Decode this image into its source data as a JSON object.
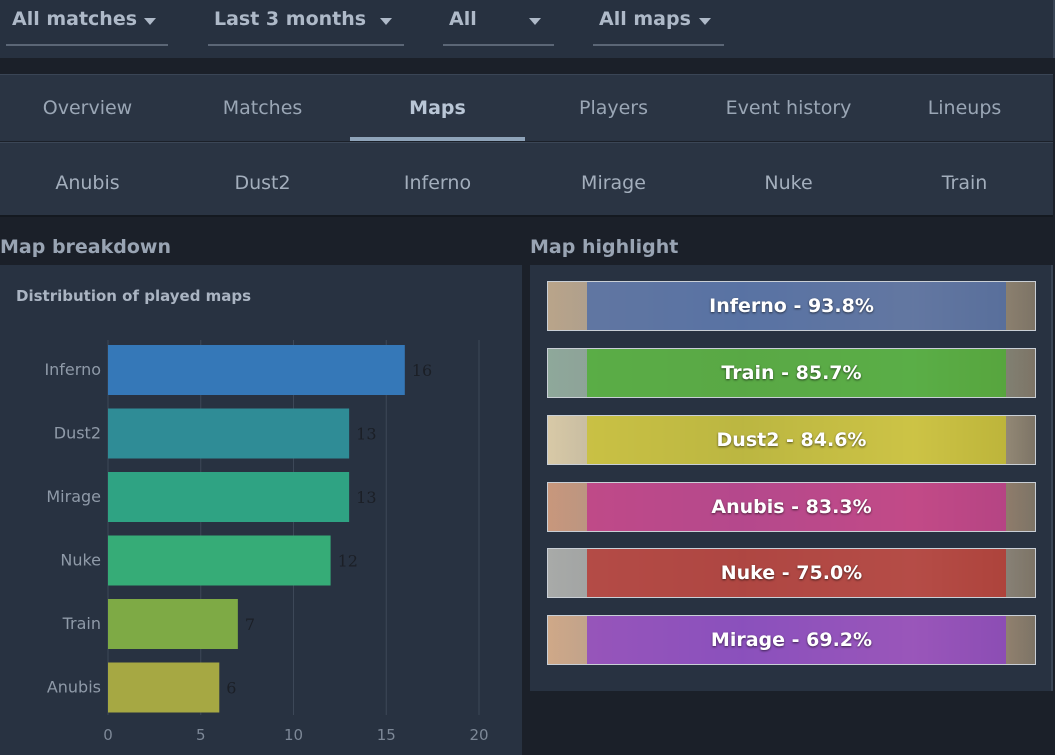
{
  "filters": [
    {
      "label": "All matches"
    },
    {
      "label": "Last 3 months"
    },
    {
      "label": "All"
    },
    {
      "label": "All maps"
    }
  ],
  "tabs": [
    "Overview",
    "Matches",
    "Maps",
    "Players",
    "Event history",
    "Lineups"
  ],
  "active_tab": "Maps",
  "subtabs": [
    "Anubis",
    "Dust2",
    "Inferno",
    "Mirage",
    "Nuke",
    "Train"
  ],
  "breakdown": {
    "section_title": "Map breakdown",
    "chart_title": "Distribution of played maps"
  },
  "highlight": {
    "section_title": "Map highlight",
    "items": [
      {
        "text": "Inferno - 93.8%",
        "color": "#4a6aa8",
        "bg": "#b9a48a"
      },
      {
        "text": "Train - 85.7%",
        "color": "#4caf2f",
        "bg": "#8ea89a"
      },
      {
        "text": "Dust2 - 84.6%",
        "color": "#c9c22a",
        "bg": "#d8c9a6"
      },
      {
        "text": "Anubis - 83.3%",
        "color": "#c0358a",
        "bg": "#c8977c"
      },
      {
        "text": "Nuke - 75.0%",
        "color": "#b8322c",
        "bg": "#a8aaa8"
      },
      {
        "text": "Mirage - 69.2%",
        "color": "#8a3fc8",
        "bg": "#cfa888"
      }
    ]
  },
  "chart_data": {
    "type": "bar",
    "orientation": "horizontal",
    "title": "Distribution of played maps",
    "categories": [
      "Inferno",
      "Dust2",
      "Mirage",
      "Nuke",
      "Train",
      "Anubis"
    ],
    "values": [
      16,
      13,
      13,
      12,
      7,
      6
    ],
    "colors": [
      "#3578b8",
      "#2f8c96",
      "#2fa383",
      "#36ac77",
      "#7eaa45",
      "#a6a843"
    ],
    "xlim": [
      0,
      20
    ],
    "xticks": [
      0,
      5,
      10,
      15,
      20
    ],
    "grid": true
  }
}
